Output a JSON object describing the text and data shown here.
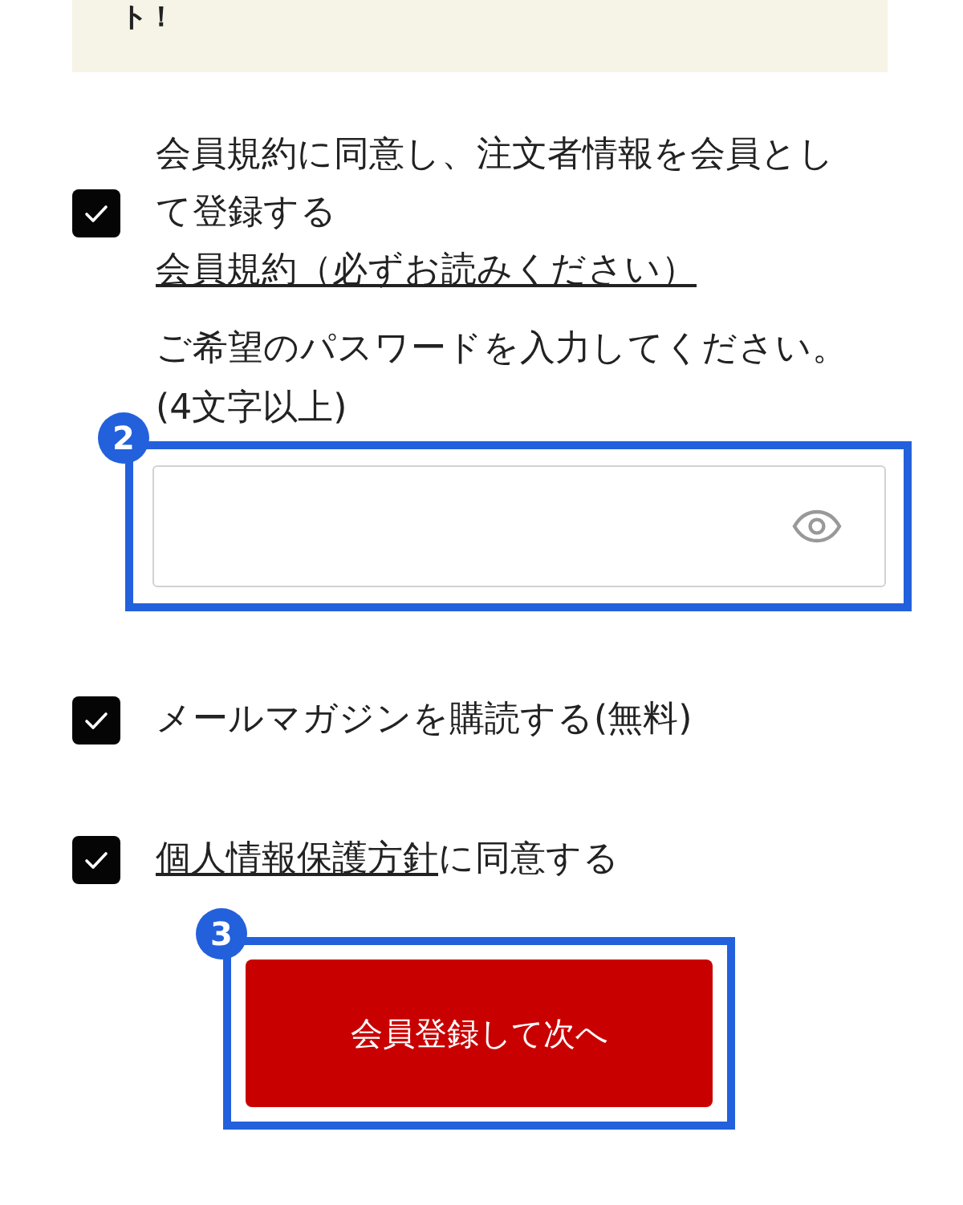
{
  "notice": {
    "text": "ト！"
  },
  "member_signup": {
    "checked": true,
    "label": "会員規約に同意し、注文者情報を会員として登録する",
    "link": "会員規約（必ずお読みください）"
  },
  "password": {
    "label": "ご希望のパスワードを入力してください。(4文字以上)",
    "annotation": "2"
  },
  "checkboxes": [
    {
      "kind": "plain",
      "checked": true,
      "text": "メールマガジンを購読する(無料)"
    },
    {
      "kind": "link-lead",
      "checked": true,
      "link": "個人情報保護方針",
      "text": "に同意する"
    }
  ],
  "submit_button": {
    "label": "会員登録して次へ",
    "annotation": "3"
  }
}
